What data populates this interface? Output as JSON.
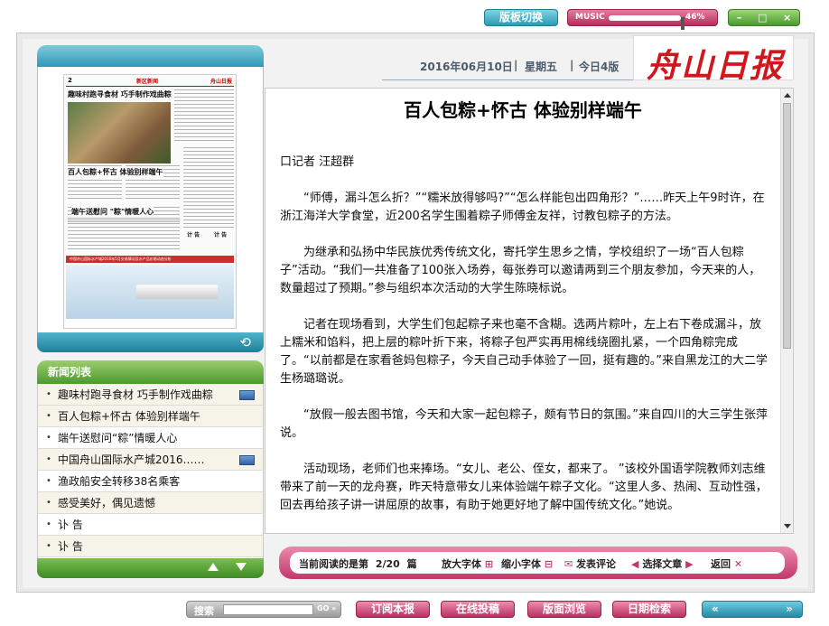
{
  "topbar": {
    "switch_label": "版板切换",
    "music_label": "MUSIC",
    "music_volume": "46%",
    "win_min": "–",
    "win_max": "□",
    "win_close": "×"
  },
  "header": {
    "date": "2016年06月10日",
    "weekday": "星期五",
    "edition": "今日4版",
    "masthead": "舟山日报"
  },
  "paper_thumb": {
    "page_no": "2",
    "section": "新区新闻",
    "logo": "舟山日报",
    "headline1": "趣味村跑寻食材 巧手制作戏曲粽",
    "headline2": "百人包粽+怀古 体验别样端午",
    "headline3": "端午送慰问 \"粽\"情暖人心",
    "headline4": "计 告",
    "headline5": "计 告",
    "banner": "中国舟山国际水产城2016年5月交易情况及水产品价格动态分析"
  },
  "news_list": {
    "title": "新闻列表",
    "items": [
      {
        "label": "趣味村跑寻食材 巧手制作戏曲粽",
        "has_image": true
      },
      {
        "label": "百人包粽+怀古 体验别样端午",
        "has_image": false
      },
      {
        "label": "端午送慰问“粽”情暖人心",
        "has_image": false
      },
      {
        "label": "中国舟山国际水产城2016……",
        "has_image": true
      },
      {
        "label": "渔政船安全转移38名乘客",
        "has_image": false
      },
      {
        "label": "感受美好，偶见遗憾",
        "has_image": false
      },
      {
        "label": "讣 告",
        "has_image": false
      },
      {
        "label": "讣 告",
        "has_image": false
      }
    ]
  },
  "article": {
    "title": "百人包粽+怀古 体验别样端午",
    "byline": "口记者 汪超群",
    "paragraphs": [
      "“师傅，漏斗怎么折？”“糯米放得够吗?”“怎么样能包出四角形？”……昨天上午9时许，在浙江海洋大学食堂，近200名学生围着粽子师傅金友祥，讨教包粽子的方法。",
      "为继承和弘扬中华民族优秀传统文化，寄托学生思乡之情，学校组织了一场“百人包粽子”活动。“我们一共准备了100张入场券，每张券可以邀请两到三个朋友参加，今天来的人，数量超过了预期。”参与组织本次活动的大学生陈晓标说。",
      "记者在现场看到，大学生们包起粽子来也毫不含糊。选两片粽叶，左上右下卷成漏斗，放上糯米和馅料，把上层的粽叶折下来，将粽子包严实再用棉线绕圈扎紧，一个四角粽完成了。“以前都是在家看爸妈包粽子，今天自己动手体验了一回，挺有趣的。”来自黑龙江的大二学生杨璐璐说。",
      "“放假一般去图书馆，今天和大家一起包粽子，颇有节日的氛围。”来自四川的大三学生张萍说。",
      "活动现场，老师们也来捧场。“女儿、老公、侄女，都来了。 ”该校外国语学院教师刘志维带来了前一天的龙舟赛，昨天特意带女儿来体验端午粽子文化。“这里人多、热闹、互动性强，回去再给孩子讲一讲屈原的故事，有助于她更好地了解中国传统文化。”她说。"
    ]
  },
  "reading_bar": {
    "current_prefix": "当前阅读的是第",
    "current_page": "2/20",
    "current_suffix": "篇",
    "enlarge": "放大字体",
    "shrink": "缩小字体",
    "comment": "发表评论",
    "choose": "选择文章",
    "back": "返回"
  },
  "bottom": {
    "search_label": "搜索",
    "search_placeholder": "",
    "search_go": "GO »",
    "subscribe": "订阅本报",
    "submit": "在线投稿",
    "browse": "版面浏览",
    "date_search": "日期检索",
    "prev": "«",
    "next": "»"
  }
}
